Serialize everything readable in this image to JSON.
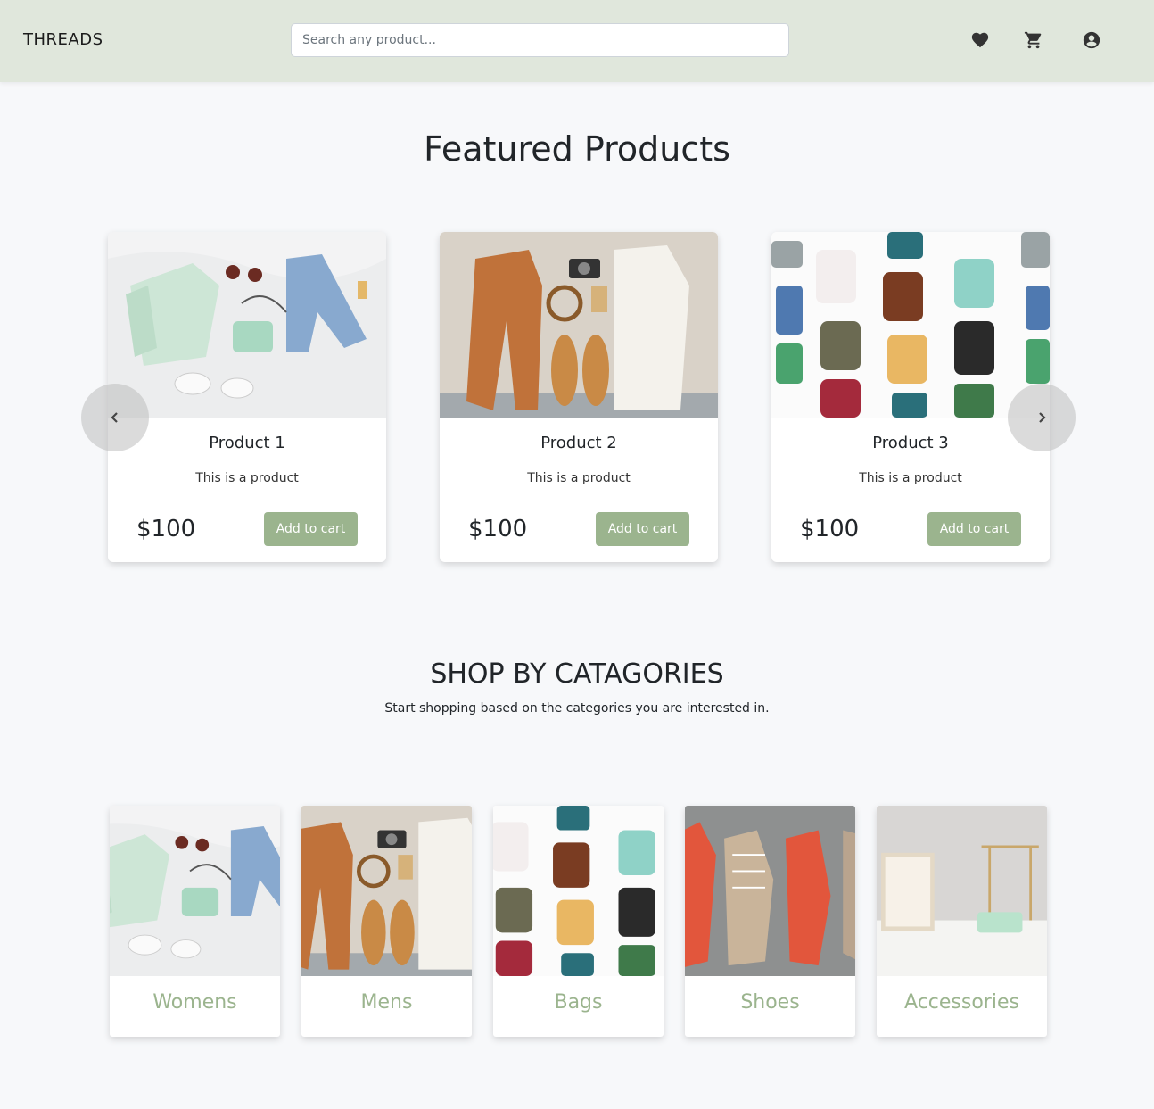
{
  "navbar": {
    "brand": "THREADS",
    "search_placeholder": "Search any product...",
    "icons": [
      "heart-icon",
      "cart-icon",
      "account-icon"
    ]
  },
  "featured": {
    "title": "Featured Products",
    "products": [
      {
        "name": "Product 1",
        "description": "This is a product",
        "price": "$100",
        "button": "Add to cart"
      },
      {
        "name": "Product 2",
        "description": "This is a product",
        "price": "$100",
        "button": "Add to cart"
      },
      {
        "name": "Product 3",
        "description": "This is a product",
        "price": "$100",
        "button": "Add to cart"
      }
    ]
  },
  "categories": {
    "title": "SHOP BY CATAGORIES",
    "subtitle": "Start shopping based on the categories you are interested in.",
    "items": [
      {
        "label": "Womens"
      },
      {
        "label": "Mens"
      },
      {
        "label": "Bags"
      },
      {
        "label": "Shoes"
      },
      {
        "label": "Accessories"
      }
    ]
  },
  "colors": {
    "navbar_bg": "#e0e7dc",
    "accent": "#9bb48e",
    "page_bg": "#f7f8fa"
  }
}
